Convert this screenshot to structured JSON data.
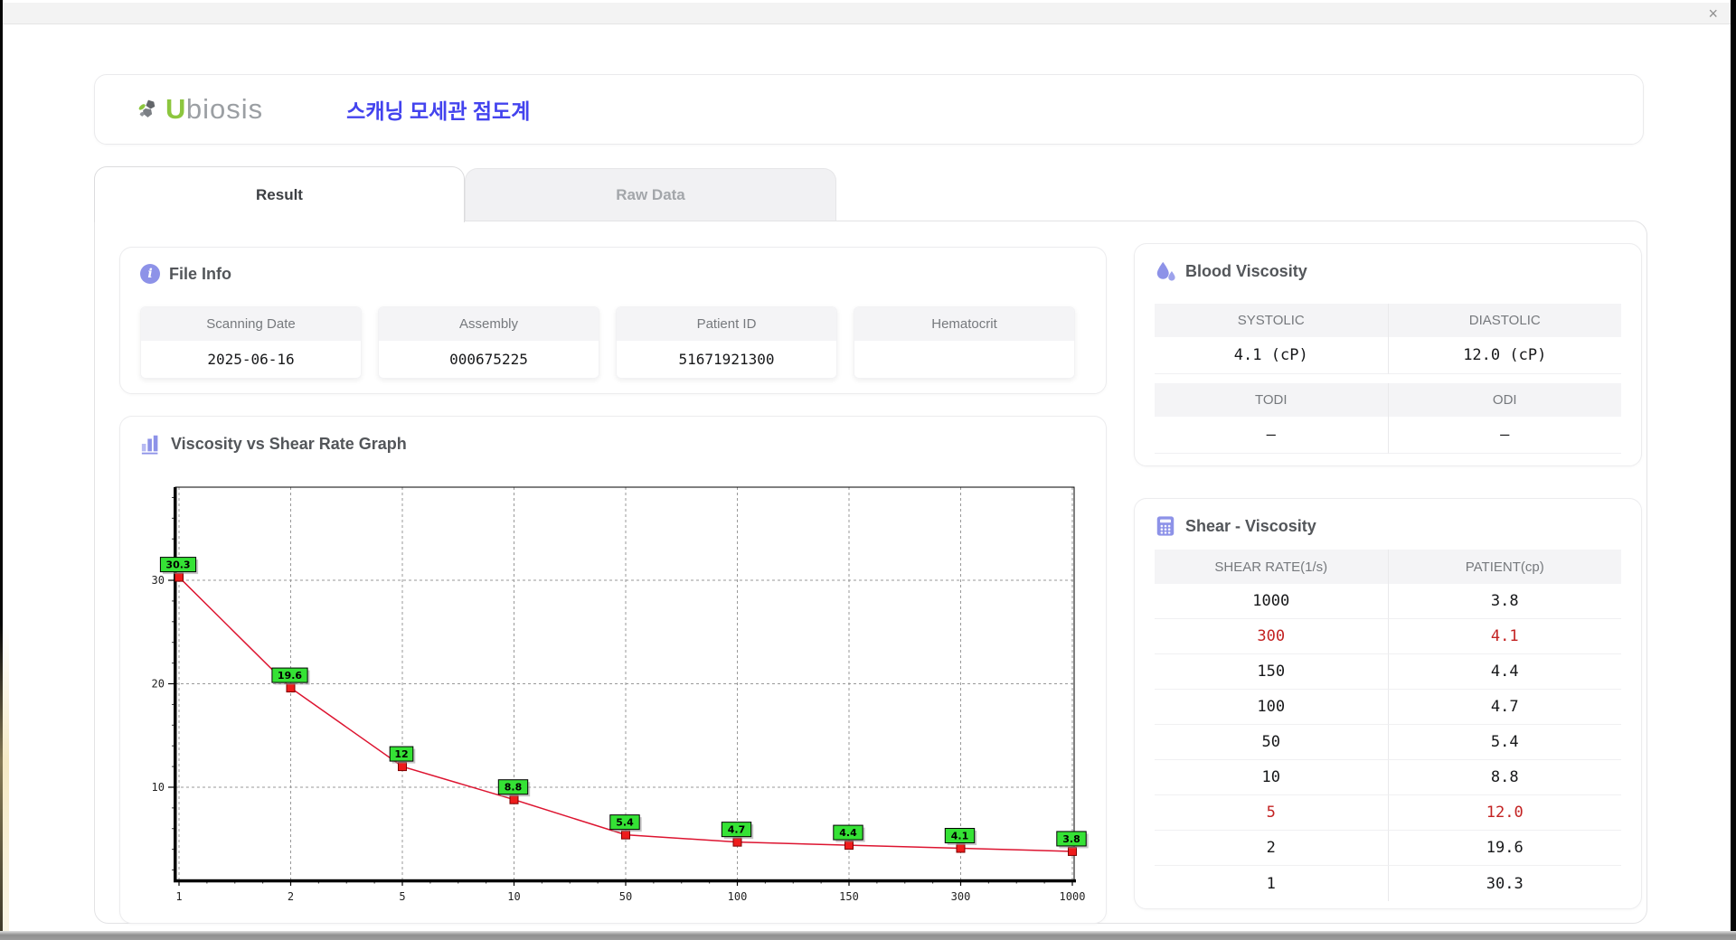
{
  "window": {
    "close_glyph": "×"
  },
  "brand": {
    "logo_text_u": "U",
    "logo_text_rest": "biosis",
    "app_title": "스캐닝 모세관 점도계"
  },
  "tabs": {
    "result": "Result",
    "raw_data": "Raw Data"
  },
  "file_info": {
    "title": "File Info",
    "fields": [
      {
        "label": "Scanning Date",
        "value": "2025-06-16"
      },
      {
        "label": "Assembly",
        "value": "000675225"
      },
      {
        "label": "Patient ID",
        "value": "51671921300"
      },
      {
        "label": "Hematocrit",
        "value": ""
      }
    ]
  },
  "blood_viscosity": {
    "title": "Blood Viscosity",
    "systolic_label": "SYSTOLIC",
    "systolic_value": "4.1 (cP)",
    "diastolic_label": "DIASTOLIC",
    "diastolic_value": "12.0 (cP)",
    "todi_label": "TODI",
    "todi_value": "–",
    "odi_label": "ODI",
    "odi_value": "–"
  },
  "graph": {
    "title": "Viscosity vs Shear Rate Graph"
  },
  "chart_data": {
    "type": "line",
    "title": "Viscosity vs Shear Rate Graph",
    "x_categories": [
      1,
      2,
      5,
      10,
      50,
      100,
      150,
      300,
      1000
    ],
    "x_spacing": "equal",
    "series": [
      {
        "name": "PATIENT(cp)",
        "values": [
          30.3,
          19.6,
          12,
          8.8,
          5.4,
          4.7,
          4.4,
          4.1,
          3.8
        ]
      }
    ],
    "point_labels": [
      "30.3",
      "19.6",
      "12",
      "8.8",
      "5.4",
      "4.7",
      "4.4",
      "4.1",
      "3.8"
    ],
    "ylim": [
      1,
      39
    ],
    "yticks": [
      10,
      20,
      30
    ],
    "y_minor_step": 2,
    "grid": true,
    "grid_style": "dashed",
    "legend": "none",
    "line_color": "#dd1430",
    "marker": "square",
    "marker_color": "#ee1c1c",
    "marker_edge_color": "#7d0000",
    "point_label_bg": "#35e235",
    "point_label_border": "#000000"
  },
  "shear_viscosity": {
    "title": "Shear - Viscosity",
    "columns": [
      "SHEAR RATE(1/s)",
      "PATIENT(cp)"
    ],
    "highlight_color": "#c32222",
    "rows": [
      {
        "shear": "1000",
        "patient": "3.8",
        "highlight": false
      },
      {
        "shear": "300",
        "patient": "4.1",
        "highlight": true
      },
      {
        "shear": "150",
        "patient": "4.4",
        "highlight": false
      },
      {
        "shear": "100",
        "patient": "4.7",
        "highlight": false
      },
      {
        "shear": "50",
        "patient": "5.4",
        "highlight": false
      },
      {
        "shear": "10",
        "patient": "8.8",
        "highlight": false
      },
      {
        "shear": "5",
        "patient": "12.0",
        "highlight": true
      },
      {
        "shear": "2",
        "patient": "19.6",
        "highlight": false
      },
      {
        "shear": "1",
        "patient": "30.3",
        "highlight": false
      }
    ]
  },
  "colors": {
    "accent_purple": "#8d92e8",
    "app_title_blue": "#4343ee",
    "brand_green": "#8cc63e",
    "header_band": "#f4f4f6"
  }
}
